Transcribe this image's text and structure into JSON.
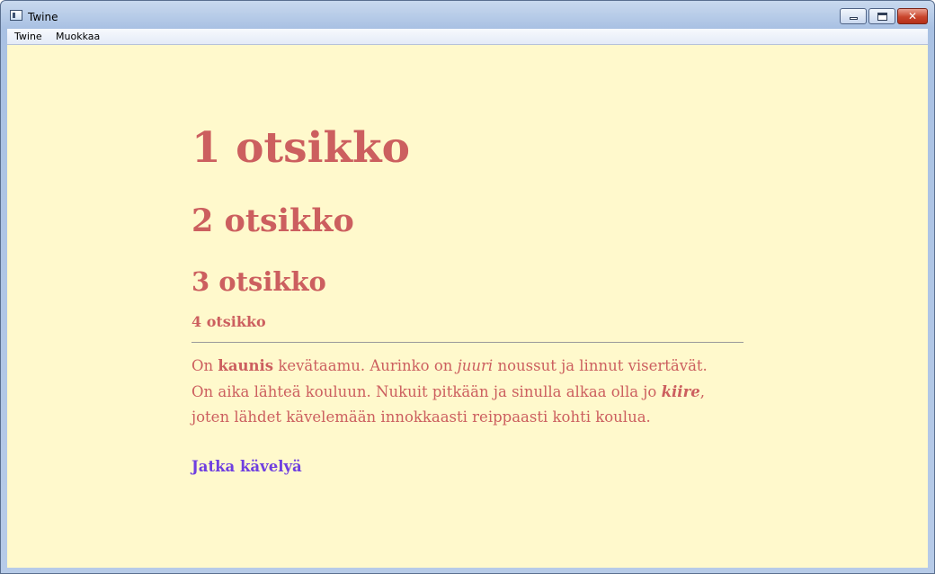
{
  "window": {
    "title": "Twine",
    "icon": "twine-app-icon",
    "buttons": {
      "minimize": "minimize-icon",
      "maximize": "maximize-icon",
      "close_glyph": "✕"
    }
  },
  "menu": {
    "items": [
      {
        "label": "Twine"
      },
      {
        "label": "Muokkaa"
      }
    ]
  },
  "story": {
    "heading1": "1 otsikko",
    "heading2": "2 otsikko",
    "heading3": "3 otsikko",
    "heading4": "4 otsikko",
    "paragraph": {
      "line1": {
        "t1": "On ",
        "bold1": "kaunis",
        "t2": " kevätaamu. Aurinko on ",
        "italic1": "juuri",
        "t3": " noussut ja linnut visertävät."
      },
      "line2": {
        "t1": "On aika lähteä kouluun. Nukuit pitkään ja sinulla alkaa olla jo ",
        "bolditalic1": "kiire",
        "t2": ","
      },
      "line3": {
        "t1": "joten lähdet kävelemään innokkaasti reippaasti kohti koulua."
      }
    },
    "link": "Jatka kävelyä"
  },
  "colors": {
    "background": "#fff9cc",
    "text": "#cc5f5f",
    "link": "#6f3fe0"
  }
}
